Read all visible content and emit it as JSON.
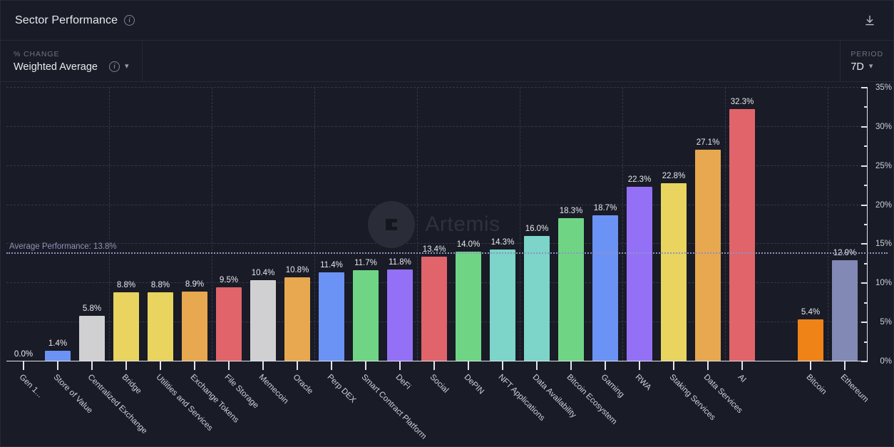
{
  "header": {
    "title": "Sector Performance",
    "info_icon": "info-icon",
    "download_icon": "download-icon"
  },
  "controls": {
    "metric": {
      "label": "% Change",
      "value": "Weighted Average",
      "info_icon": "info-icon",
      "chevron_icon": "chevron-down-icon"
    },
    "period": {
      "label": "Period",
      "value": "7D",
      "chevron_icon": "chevron-down-icon"
    }
  },
  "watermark": {
    "text": "Artemis"
  },
  "chart_data": {
    "type": "bar",
    "title": "Sector Performance",
    "xlabel": "",
    "ylabel": "",
    "ylim": [
      0,
      35
    ],
    "yticks": [
      0,
      5,
      10,
      15,
      20,
      25,
      30,
      35
    ],
    "ytick_labels": [
      "0%",
      "5%",
      "10%",
      "15%",
      "20%",
      "25%",
      "30%",
      "35%"
    ],
    "minor_tick_step": 2.5,
    "grid": true,
    "legend": "none",
    "value_label_format": "0.0%",
    "annotations": [
      {
        "name": "average-performance",
        "text": "Average Performance: 13.8%",
        "value": 13.8,
        "style": "dotted-line"
      }
    ],
    "categories": [
      "Gen 1...",
      "Store of Value",
      "Centralized Exchange",
      "Bridge",
      "Utilities and Services",
      "Exchange Tokens",
      "File Storage",
      "Memecoin",
      "Oracle",
      "Perp DEX",
      "Smart Contract Platform",
      "DeFi",
      "Social",
      "DePIN",
      "NFT Applications",
      "Data Availability",
      "Bitcoin Ecosystem",
      "Gaming",
      "RWA",
      "Staking Services",
      "Data Services",
      "AI",
      "",
      "Bitcoin",
      "Ethereum"
    ],
    "values": [
      0.0,
      1.4,
      5.8,
      8.8,
      8.8,
      8.9,
      9.5,
      10.4,
      10.8,
      11.4,
      11.7,
      11.8,
      13.4,
      14.0,
      14.3,
      16.0,
      18.3,
      18.7,
      22.3,
      22.8,
      27.1,
      32.3,
      null,
      5.4,
      12.9
    ],
    "value_labels": [
      "0.0%",
      "1.4%",
      "5.8%",
      "8.8%",
      "8.8%",
      "8.9%",
      "9.5%",
      "10.4%",
      "10.8%",
      "11.4%",
      "11.7%",
      "11.8%",
      "13.4%",
      "14.0%",
      "14.3%",
      "16.0%",
      "18.3%",
      "18.7%",
      "22.3%",
      "22.8%",
      "27.1%",
      "32.3%",
      "",
      "5.4%",
      "12.9%"
    ],
    "colors": [
      "#6b93f5",
      "#6b93f5",
      "#d0d0d2",
      "#e8d45f",
      "#e8d45f",
      "#e8a84f",
      "#e0646a",
      "#d0d0d2",
      "#e8a84f",
      "#6b93f5",
      "#6fd585",
      "#9470f7",
      "#e0646a",
      "#6fd585",
      "#7cd5c8",
      "#7cd5c8",
      "#6fd585",
      "#6b93f5",
      "#9470f7",
      "#e8d45f",
      "#e8a84f",
      "#e0646a",
      "transparent",
      "#f08318",
      "#8289b5"
    ]
  },
  "colors": {
    "background": "#191b26",
    "border": "#262938",
    "axis": "#e3e5ec",
    "grid": "#343848",
    "avg_line": "#8f93c4",
    "text_primary": "#e8eaf0",
    "text_muted": "#6e7488"
  }
}
